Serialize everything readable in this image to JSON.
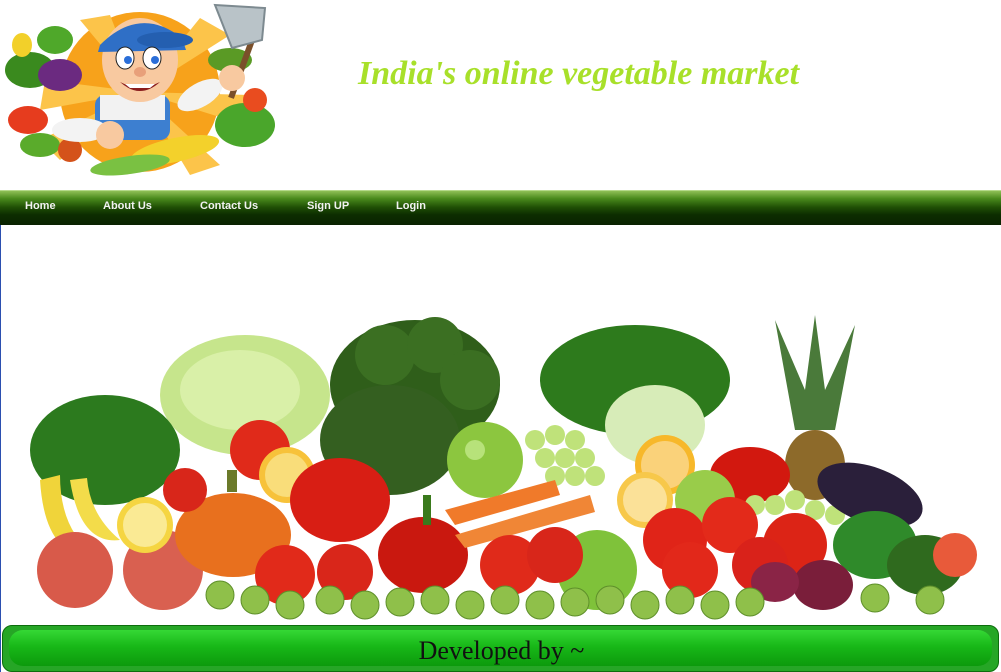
{
  "header": {
    "site_title": "India's online vegetable market",
    "logo_icon": "farmer-mascot-icon"
  },
  "nav": {
    "items": [
      {
        "label": "Home"
      },
      {
        "label": "About Us"
      },
      {
        "label": "Contact Us"
      },
      {
        "label": "Sign UP"
      },
      {
        "label": "Login"
      }
    ]
  },
  "hero": {
    "image_icon": "vegetables-banner-icon"
  },
  "footer": {
    "text": "Developed by ~"
  },
  "colors": {
    "title": "#a8e02a",
    "nav_dark": "#0c2d00",
    "nav_light": "#4a8a1c",
    "footer_green": "#18b818"
  }
}
